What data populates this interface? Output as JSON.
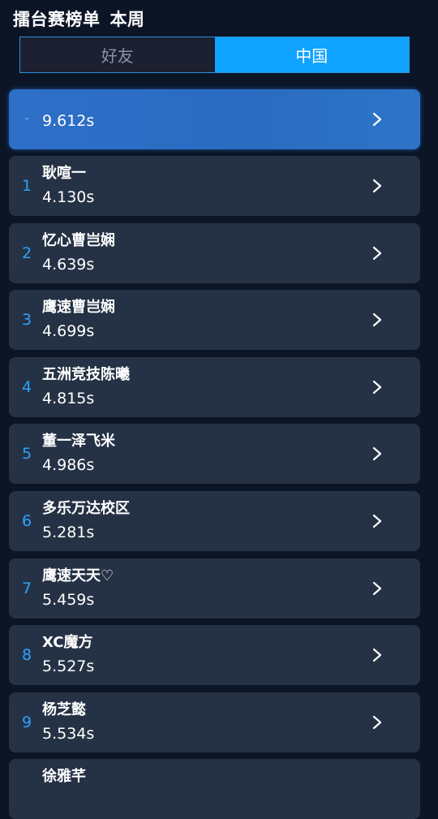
{
  "header": {
    "title": "擂台赛榜单",
    "period": "本周"
  },
  "tabs": [
    {
      "label": "好友",
      "active": false
    },
    {
      "label": "中国",
      "active": true
    }
  ],
  "me": {
    "rank": "-",
    "time": "9.612s"
  },
  "rows": [
    {
      "rank": "1",
      "name": "耿喧一",
      "time": "4.130s"
    },
    {
      "rank": "2",
      "name": "忆心曹岂娴",
      "time": "4.639s"
    },
    {
      "rank": "3",
      "name": "鹰速曹岂娴",
      "time": "4.699s"
    },
    {
      "rank": "4",
      "name": "五洲竞技陈曦",
      "time": "4.815s"
    },
    {
      "rank": "5",
      "name": "董一泽飞米",
      "time": "4.986s"
    },
    {
      "rank": "6",
      "name": "多乐万达校区",
      "time": "5.281s"
    },
    {
      "rank": "7",
      "name": "鹰速天天♡",
      "time": "5.459s"
    },
    {
      "rank": "8",
      "name": "XC魔方",
      "time": "5.527s"
    },
    {
      "rank": "9",
      "name": "杨芝懿",
      "time": "5.534s"
    },
    {
      "rank": "",
      "name": "徐雅芊",
      "time": ""
    }
  ]
}
